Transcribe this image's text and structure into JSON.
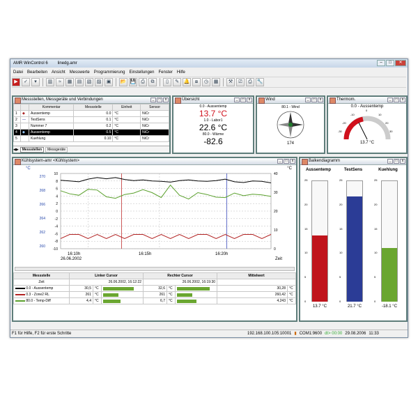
{
  "window": {
    "app_title": "AMR WinControl 6",
    "doc_title": "linedg.amr"
  },
  "menu": [
    "Datei",
    "Bearbeiten",
    "Ansicht",
    "Messwerte",
    "Programmierung",
    "Einstellungen",
    "Fenster",
    "Hilfe"
  ],
  "panels": {
    "devices": {
      "title": "Messstellen, Messgeräte und Verbindungen",
      "tab1": "Messstellen",
      "tab2": "Messgeräte",
      "headers": [
        "",
        "",
        "Kommentar",
        "Messstelle",
        "Einheit",
        "Sensor"
      ],
      "rows": [
        {
          "no": "1",
          "name": "Aussentemp",
          "val": "0.0",
          "unit": "°C",
          "sensor": "NiCr"
        },
        {
          "no": "2",
          "name": "TestSens",
          "val": "0.1",
          "unit": "°C",
          "sensor": "NiCr"
        },
        {
          "no": "3",
          "name": "Nummer 7",
          "val": "0.2",
          "unit": "°C",
          "sensor": "NiCr"
        },
        {
          "no": "4",
          "name": "Aussentemp",
          "val": "0.5",
          "unit": "°C",
          "sensor": "NiCr"
        },
        {
          "no": "5",
          "name": "Kuehlung",
          "val": "0.10",
          "unit": "°C",
          "sensor": "NiCr"
        }
      ]
    },
    "overview": {
      "title": "Übersicht",
      "l1": "0.0 - Aussentemp",
      "v1": "13.7 °C",
      "l2": "1.0 - Labor1",
      "v2": "22.6 °C",
      "l3": "80.0 - Wärme",
      "v3": "-82.6"
    },
    "wind": {
      "title": "Wind",
      "label": "80.1 - Wind",
      "value": "174"
    },
    "thermo": {
      "title": "Thermom.",
      "label": "0.0 - Aussentemp",
      "value": "13.7 °C",
      "ticks": [
        "0",
        "10",
        "20",
        "30",
        "-10",
        "-20",
        "-30"
      ]
    },
    "chart": {
      "title": "Kühlsystem-amr <Kühlsystem>",
      "left_unit": "°C",
      "right_unit": "°C",
      "xunit": "Zeit",
      "xticks": [
        {
          "t": "16:10h",
          "d": "26.06.2002"
        },
        {
          "t": "16:15h",
          "d": ""
        },
        {
          "t": "16:20h",
          "d": ""
        }
      ]
    },
    "cursor": {
      "h_mess": "Messstelle",
      "h_left": "Linker Cursor",
      "h_right": "Rechter Cursor",
      "h_mean": "Mittelwert",
      "h_zeit": "Zeit",
      "left_time": "26.06.2002, 16:12:22",
      "right_time": "26.06.2002, 16:19:30",
      "rows": [
        {
          "name": "0.0 - Aussentemp",
          "lv": "30,5",
          "lu": "°C",
          "rv": "32,6",
          "ru": "°C",
          "mv": "30,28",
          "mu": "°C",
          "color": "#000000"
        },
        {
          "name": "0.3 - Zone2 RL",
          "lv": "261",
          "lu": "°C",
          "rv": "261",
          "ru": "°C",
          "mv": "260,42",
          "mu": "°C",
          "color": "#b22222"
        },
        {
          "name": "80.0 - Temp-Diff",
          "lv": "4,4",
          "lu": "°C",
          "rv": "6,7",
          "ru": "°C",
          "mv": "4,243",
          "mu": "°C",
          "color": "#5aa02c"
        }
      ]
    },
    "bars": {
      "title": "Balkendiagramm",
      "items": [
        {
          "name": "Aussentemp",
          "value": "13.7 °C",
          "level": 13.7,
          "color": "#c0141c"
        },
        {
          "name": "TestSens",
          "value": "21.7 °C",
          "level": 21.7,
          "color": "#2b3c96"
        },
        {
          "name": "Kuehlung",
          "value": "-18.1 °C",
          "level": 11,
          "color": "#6aa630"
        }
      ],
      "ticks": [
        "25",
        "20",
        "15",
        "10",
        "5",
        "0"
      ]
    }
  },
  "status": {
    "left": "F1 für Hilfe, F2 für erste Schritte",
    "ip": "192.168.100.105:10001",
    "com": "COM1:9600",
    "dt": "dt> 00:00",
    "date": "29.08.2006",
    "time": "11:33"
  },
  "chart_data": {
    "type": "line",
    "x_label": "Zeit",
    "x": [
      "16:10h",
      "16:15h",
      "16:20h"
    ],
    "left_axis": {
      "unit": "°C",
      "ticks": [
        10,
        8,
        6,
        4,
        2,
        0,
        -2,
        -4,
        -6,
        -8,
        -10
      ],
      "outer_ticks": [
        270,
        268,
        266,
        264,
        262,
        260
      ]
    },
    "right_axis": {
      "unit": "°C",
      "ticks": [
        40,
        30,
        20,
        10,
        0
      ]
    },
    "series": [
      {
        "name": "0.0 - Aussentemp",
        "color": "#000000",
        "values": [
          8.2,
          8.0,
          7.8,
          8.5,
          8.9,
          8.6,
          8.9,
          8.4,
          8.1,
          8.3,
          8.0,
          7.9,
          7.7,
          8.1,
          8.3,
          8.0,
          7.9,
          8.1,
          8.5,
          7.8,
          7.6,
          8.0,
          7.9,
          7.5
        ]
      },
      {
        "name": "80.0 - Temp-Diff",
        "color": "#5aa02c",
        "values": [
          5.4,
          4.6,
          4.2,
          5.8,
          5.6,
          3.8,
          3.4,
          4.4,
          4.8,
          5.7,
          4.9,
          3.6,
          6.9,
          4.2,
          3.2,
          4.9,
          4.4,
          3.7,
          3.6,
          4.8,
          4.1,
          4.5,
          4.3,
          3.9
        ]
      },
      {
        "name": "0.3 - Zone2 RL",
        "color": "#b22222",
        "values": [
          -7.3,
          -6.2,
          -6.2,
          -7.3,
          -6.2,
          -7.3,
          -6.2,
          -7.3,
          -6.2,
          -6.2,
          -7.3,
          -6.2,
          -7.3,
          -6.2,
          -7.3,
          -6.2,
          -6.2,
          -7.3,
          -6.2,
          -7.3,
          -6.2,
          -6.2,
          -7.3,
          -6.2
        ]
      }
    ],
    "cursors": [
      {
        "name": "left",
        "pos": 0.29,
        "color": "#c03030"
      },
      {
        "name": "right",
        "pos": 0.79,
        "color": "#4050c0"
      }
    ]
  }
}
